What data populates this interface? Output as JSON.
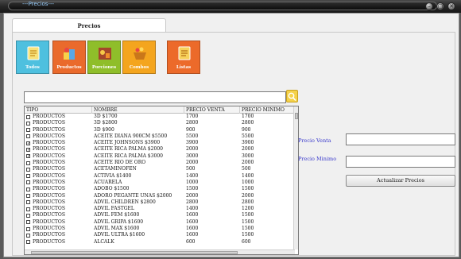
{
  "window": {
    "title": "---Precios---"
  },
  "tab": {
    "label": "Precios"
  },
  "tiles": [
    {
      "label": "Todos",
      "color": "#4ec0df",
      "icon": "list-icon"
    },
    {
      "label": "Productos",
      "color": "#ea6a2c",
      "icon": "products-icon"
    },
    {
      "label": "Porciones",
      "color": "#8fbe2a",
      "icon": "portions-icon"
    },
    {
      "label": "Combos",
      "color": "#f4a51e",
      "icon": "combos-icon"
    },
    {
      "label": "Listas",
      "color": "#ec6a2a",
      "icon": "lists-icon"
    }
  ],
  "search": {
    "value": "",
    "icon": "search-icon"
  },
  "table": {
    "columns": [
      "TIPO",
      "NOMBRE",
      "PRECIO VENTA",
      "PRECIO MINIMO"
    ],
    "rows": [
      {
        "checked": false,
        "tipo": "PRODUCTOS",
        "nombre": "3D $1700",
        "venta": "1700",
        "minimo": "1700"
      },
      {
        "checked": false,
        "tipo": "PRODUCTOS",
        "nombre": "3D $2800",
        "venta": "2800",
        "minimo": "2800"
      },
      {
        "checked": false,
        "tipo": "PRODUCTOS",
        "nombre": "3D $900",
        "venta": "900",
        "minimo": "900"
      },
      {
        "checked": false,
        "tipo": "PRODUCTOS",
        "nombre": "ACEITE DIANA 900CM $5500",
        "venta": "5500",
        "minimo": "5500"
      },
      {
        "checked": true,
        "tipo": "PRODUCTOS",
        "nombre": "ACEITE JOHNSONS $3900",
        "venta": "3900",
        "minimo": "3900"
      },
      {
        "checked": true,
        "tipo": "PRODUCTOS",
        "nombre": "ACEITE RICA PALMA $2000",
        "venta": "2000",
        "minimo": "2000"
      },
      {
        "checked": true,
        "tipo": "PRODUCTOS",
        "nombre": "ACEITE RICA PALMA $3000",
        "venta": "3000",
        "minimo": "3000"
      },
      {
        "checked": false,
        "tipo": "PRODUCTOS",
        "nombre": "ACEITE RIO DE ORO",
        "venta": "2000",
        "minimo": "2000"
      },
      {
        "checked": false,
        "tipo": "PRODUCTOS",
        "nombre": "ACETAMINOFEN",
        "venta": "500",
        "minimo": "500"
      },
      {
        "checked": false,
        "tipo": "PRODUCTOS",
        "nombre": "ACTIVIA $1400",
        "venta": "1400",
        "minimo": "1400"
      },
      {
        "checked": false,
        "tipo": "PRODUCTOS",
        "nombre": "ACUARELA",
        "venta": "1000",
        "minimo": "1000"
      },
      {
        "checked": false,
        "tipo": "PRODUCTOS",
        "nombre": "ADOBO $1500",
        "venta": "1500",
        "minimo": "1500"
      },
      {
        "checked": false,
        "tipo": "PRODUCTOS",
        "nombre": "ADORO PEGANTE UÑAS $2000",
        "venta": "2000",
        "minimo": "2000"
      },
      {
        "checked": false,
        "tipo": "PRODUCTOS",
        "nombre": "ADVIL CHILDREN $2800",
        "venta": "2800",
        "minimo": "2800"
      },
      {
        "checked": false,
        "tipo": "PRODUCTOS",
        "nombre": "ADVIL FASTGEL",
        "venta": "1400",
        "minimo": "1200"
      },
      {
        "checked": false,
        "tipo": "PRODUCTOS",
        "nombre": "ADVIL FEM $1600",
        "venta": "1600",
        "minimo": "1500"
      },
      {
        "checked": false,
        "tipo": "PRODUCTOS",
        "nombre": "ADVIL GRIPA $1600",
        "venta": "1600",
        "minimo": "1500"
      },
      {
        "checked": false,
        "tipo": "PRODUCTOS",
        "nombre": "ADVIL MAX $1600",
        "venta": "1600",
        "minimo": "1500"
      },
      {
        "checked": false,
        "tipo": "PRODUCTOS",
        "nombre": "ADVIL ULTRA $1600",
        "venta": "1600",
        "minimo": "1500"
      },
      {
        "checked": false,
        "tipo": "PRODUCTOS",
        "nombre": "ALCALK",
        "venta": "600",
        "minimo": "600"
      }
    ]
  },
  "form": {
    "precio_venta_label": "Precio Venta",
    "precio_venta_value": "",
    "precio_minimo_label": "Precio Minimo",
    "precio_minimo_value": "",
    "update_button": "Actualizar Precios"
  }
}
